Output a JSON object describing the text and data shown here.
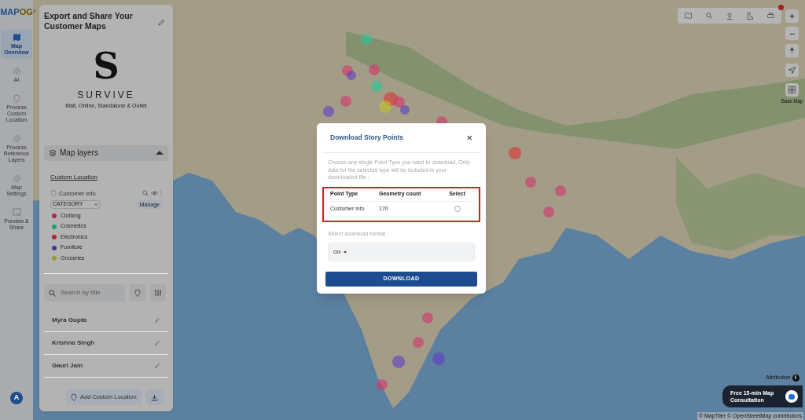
{
  "logo": {
    "part_1": "MAP",
    "part_2": "OG"
  },
  "expand_arrow": "›",
  "nav": [
    {
      "label": "Map Overview",
      "selected": true
    },
    {
      "label": "AI",
      "selected": false
    },
    {
      "label": "Process Custom Location",
      "selected": false
    },
    {
      "label": "Process Reference Layers",
      "selected": false
    },
    {
      "label": "Map Settings",
      "selected": false
    },
    {
      "label": "Preview & Share",
      "selected": false
    }
  ],
  "user_avatar": "A",
  "panel": {
    "title": "Export and Share Your Customer Maps",
    "brand": {
      "letter": "S",
      "name": "SURVIVE",
      "tagline": "Mall, Online, Standalone & Outlet"
    },
    "layers_header": "Map layers",
    "group": "Custom Location",
    "layer": "Customer info",
    "attribute": "CATEGORY",
    "manage": "Manage",
    "legend": [
      {
        "label": "Clothing",
        "color": "#a82a55"
      },
      {
        "label": "Cosmetics",
        "color": "#1d9d78"
      },
      {
        "label": "Electronics",
        "color": "#b02626"
      },
      {
        "label": "Furniture",
        "color": "#4b3399"
      },
      {
        "label": "Groceries",
        "color": "#9b9c24"
      }
    ],
    "search": {
      "placeholder": "Search by title"
    },
    "points": [
      "Myra Gupta",
      "Krishna Singh",
      "Gauri Jain"
    ],
    "add_button": "Add Custom Location"
  },
  "map_controls": {
    "zoom_in": "+",
    "zoom_out": "−",
    "info": "i",
    "base_map": "Base Map",
    "attribution": "Attribution",
    "consultation": "Free 15-min Map Consultation",
    "credits": "© MapTiler © OpenStreetMap contributors"
  },
  "dialog": {
    "title": "Download Story Points",
    "close": "×",
    "description": "Choose any single Point Type you want to download, Only data for the selected type will be included in your downloaded file :",
    "columns": [
      "Point Type",
      "Geometry count",
      "Select"
    ],
    "rows": [
      {
        "point_type": "Customer info",
        "count": "170",
        "selected": false
      }
    ],
    "format_label": "Select download format",
    "format": "csv",
    "download": "DOWNLOAD"
  }
}
